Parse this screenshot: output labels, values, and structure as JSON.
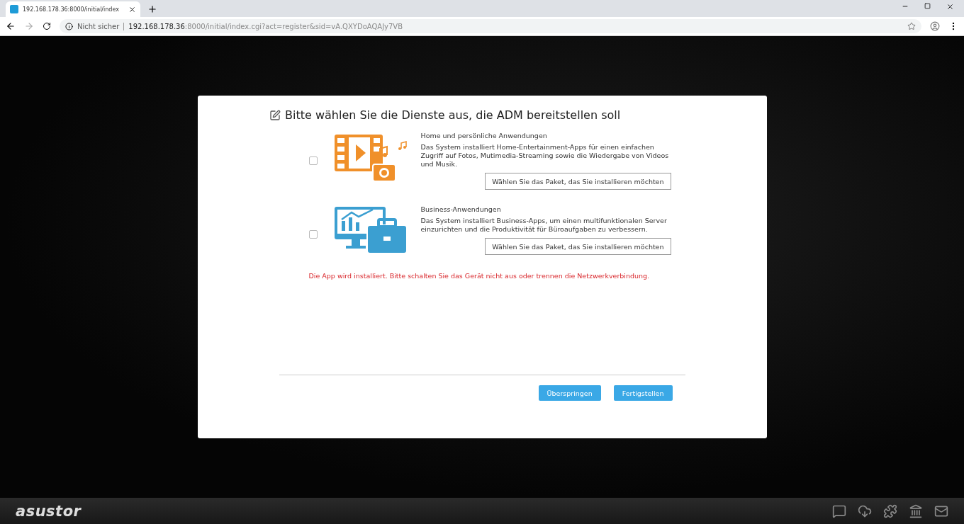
{
  "browser": {
    "tab_title": "192.168.178.36:8000/initial/index",
    "security": "Nicht sicher",
    "url_host": "192.168.178.36",
    "url_rest": ":8000/initial/index.cgi?act=register&sid=vA.QXYDoAQAJy7VB"
  },
  "dialog": {
    "title": "Bitte wählen Sie die Dienste aus, die ADM bereitstellen soll",
    "services": [
      {
        "kind": "home",
        "name": "Home und persönliche Anwendungen",
        "description": "Das System installiert Home-Entertainment-Apps für einen einfachen Zugriff auf Fotos, Mutimedia-Streaming sowie die Wiedergabe von Videos und Musik.",
        "button": "Wählen Sie das Paket, das Sie installieren möchten",
        "checked": false
      },
      {
        "kind": "business",
        "name": "Business-Anwendungen",
        "description": "Das System installiert Business-Apps, um einen multifunktionalen Server einzurichten und die Produktivität für Büroaufgaben zu verbessern.",
        "button": "Wählen Sie das Paket, das Sie installieren möchten",
        "checked": false
      }
    ],
    "warning": "Die App wird installiert. Bitte schalten Sie das Gerät nicht aus oder trennen die Netzwerkverbindung.",
    "buttons": [
      "Überspringen",
      "Fertigstellen"
    ]
  },
  "footer": {
    "logo": "asustor"
  }
}
